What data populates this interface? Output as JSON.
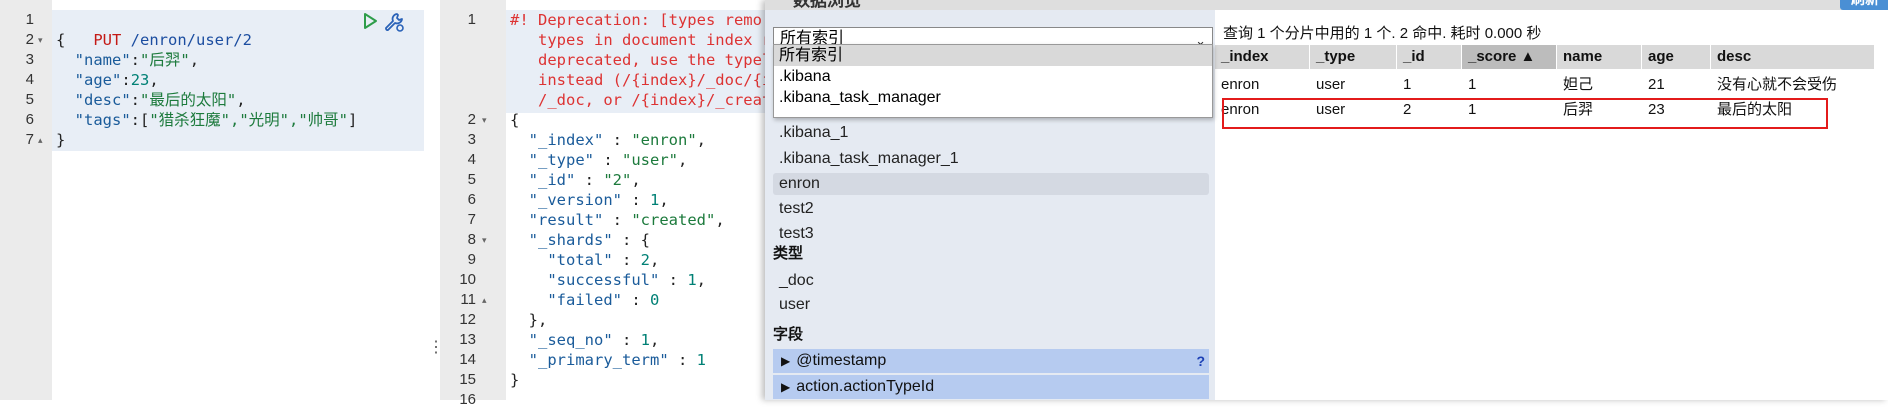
{
  "editor": {
    "line_numbers": [
      "1",
      "2",
      "3",
      "4",
      "5",
      "6",
      "7"
    ],
    "request_method": "PUT",
    "request_path": " /enron/user/2",
    "open_brace": "{",
    "close_brace": "}",
    "fields": [
      {
        "key": "\"name\"",
        "sep": ":",
        "value": "\"后羿\"",
        "tail": ","
      },
      {
        "key": "\"age\"",
        "sep": ":",
        "value": "23",
        "tail": ","
      },
      {
        "key": "\"desc\"",
        "sep": ":",
        "value": "\"最后的太阳\"",
        "tail": ","
      },
      {
        "key": "\"tags\"",
        "sep": ":[",
        "value": "\"猎杀狂魔\",\"光明\",\"帅哥\"",
        "tail": "]"
      }
    ],
    "run_icon": "play-icon",
    "settings_icon": "wrench-icon",
    "splitter_glyph": "⋮"
  },
  "output": {
    "line_numbers": [
      "1",
      "",
      "",
      "",
      "",
      "2",
      "3",
      "4",
      "5",
      "6",
      "7",
      "8",
      "9",
      "10",
      "11",
      "12",
      "13",
      "14",
      "15",
      "16"
    ],
    "warning_lines": [
      "#! Deprecation: [types remo",
      "   types in document index r",
      "   deprecated, use the typel",
      "   instead (/{index}/_doc/{i",
      "   /_doc, or /{index}/_creat"
    ],
    "json_lines": [
      {
        "indent": "",
        "key": "",
        "value": "{",
        "vclass": "k-dark"
      },
      {
        "indent": "  ",
        "key": "\"_index\"",
        "sep": " : ",
        "value": "\"enron\"",
        "tail": ",",
        "vclass": "k-str"
      },
      {
        "indent": "  ",
        "key": "\"_type\"",
        "sep": " : ",
        "value": "\"user\"",
        "tail": ",",
        "vclass": "k-str"
      },
      {
        "indent": "  ",
        "key": "\"_id\"",
        "sep": " : ",
        "value": "\"2\"",
        "tail": ",",
        "vclass": "k-str"
      },
      {
        "indent": "  ",
        "key": "\"_version\"",
        "sep": " : ",
        "value": "1",
        "tail": ",",
        "vclass": "k-num"
      },
      {
        "indent": "  ",
        "key": "\"result\"",
        "sep": " : ",
        "value": "\"created\"",
        "tail": ",",
        "vclass": "k-str"
      },
      {
        "indent": "  ",
        "key": "\"_shards\"",
        "sep": " : ",
        "value": "{",
        "tail": "",
        "vclass": "k-dark"
      },
      {
        "indent": "    ",
        "key": "\"total\"",
        "sep": " : ",
        "value": "2",
        "tail": ",",
        "vclass": "k-num"
      },
      {
        "indent": "    ",
        "key": "\"successful\"",
        "sep": " : ",
        "value": "1",
        "tail": ",",
        "vclass": "k-num"
      },
      {
        "indent": "    ",
        "key": "\"failed\"",
        "sep": " : ",
        "value": "0",
        "tail": "",
        "vclass": "k-num"
      },
      {
        "indent": "  ",
        "key": "",
        "value": "},",
        "vclass": "k-dark"
      },
      {
        "indent": "  ",
        "key": "\"_seq_no\"",
        "sep": " : ",
        "value": "1",
        "tail": ",",
        "vclass": "k-num"
      },
      {
        "indent": "  ",
        "key": "\"_primary_term\"",
        "sep": " : ",
        "value": "1",
        "tail": "",
        "vclass": "k-num"
      },
      {
        "indent": "",
        "key": "",
        "value": "}",
        "vclass": "k-dark"
      },
      {
        "indent": "",
        "key": "",
        "value": "",
        "vclass": "k-dark"
      }
    ]
  },
  "browser": {
    "title": "数据浏览",
    "refresh_label": "刷新",
    "index_select_value": "所有索引",
    "dropdown_options": [
      "所有索引",
      ".kibana",
      ".kibana_task_manager"
    ],
    "indices": [
      ".kibana_1",
      ".kibana_task_manager_1",
      "enron",
      "test2",
      "test3"
    ],
    "active_index": "enron",
    "types_heading": "类型",
    "types": [
      "_doc",
      "user"
    ],
    "fields_heading": "字段",
    "fields": [
      "@timestamp",
      "action.actionTypeId"
    ],
    "help_glyph": "?",
    "summary": "查询 1 个分片中用的 1 个. 2 命中. 耗时 0.000 秒",
    "columns": [
      "_index",
      "_type",
      "_id",
      "_score ▲",
      "name",
      "age",
      "desc"
    ],
    "sorted_column": "_score",
    "rows": [
      [
        "enron",
        "user",
        "1",
        "1",
        "妲己",
        "21",
        "没有心就不会受伤"
      ],
      [
        "enron",
        "user",
        "2",
        "1",
        "后羿",
        "23",
        "最后的太阳"
      ]
    ],
    "highlight_color": "#e31b1b"
  }
}
